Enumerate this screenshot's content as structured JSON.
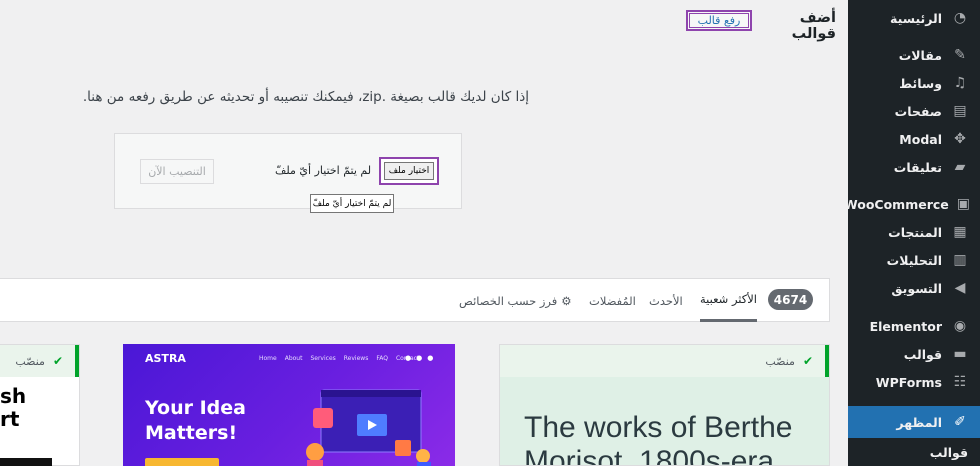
{
  "sidebar": {
    "items": [
      {
        "label": "الرئيسية",
        "icon": "dashboard-icon"
      },
      {
        "label": "مقالات",
        "icon": "pin-icon"
      },
      {
        "label": "وسائط",
        "icon": "media-icon"
      },
      {
        "label": "صفحات",
        "icon": "pages-icon"
      },
      {
        "label": "Modal",
        "icon": "move-icon"
      },
      {
        "label": "تعليقات",
        "icon": "comment-icon"
      },
      {
        "label": "WooCommerce",
        "icon": "woo-icon"
      },
      {
        "label": "المنتجات",
        "icon": "products-icon"
      },
      {
        "label": "التحليلات",
        "icon": "analytics-icon"
      },
      {
        "label": "التسويق",
        "icon": "megaphone-icon"
      },
      {
        "label": "Elementor",
        "icon": "elementor-icon"
      },
      {
        "label": "قوالب",
        "icon": "folder-icon"
      },
      {
        "label": "WPForms",
        "icon": "forms-icon"
      },
      {
        "label": "المظهر",
        "icon": "brush-icon"
      },
      {
        "label": "قوالب",
        "icon": ""
      }
    ]
  },
  "header": {
    "title": "أضف قوالب",
    "upload_label": "رفع قالب"
  },
  "upload": {
    "description": "إذا كان لديك قالب بصيغة .zip، فيمكنك تنصيبه أو تحديثه عن طريق رفعه من هنا.",
    "choose_label": "اختيار ملف",
    "no_file": "لم يتمّ اختيار أيّ ملفّ",
    "tooltip": "لم يتمّ اختيار أيّ ملفّ",
    "install_label": "التنصيب الآن"
  },
  "filter": {
    "count": "4674",
    "tabs": [
      {
        "label": "الأكثر شعبية",
        "active": true
      },
      {
        "label": "الأحدث",
        "active": false
      },
      {
        "label": "المُفضلات",
        "active": false
      },
      {
        "label": "فرز حسب الخصائص",
        "active": false
      }
    ]
  },
  "themes": {
    "installed_label": "منصّب",
    "left_text_1": "sh",
    "left_text_2": "rt",
    "astra": {
      "logo": "ASTRA",
      "nav": [
        "Home",
        "About",
        "Services",
        "Reviews",
        "FAQ",
        "Contact"
      ],
      "title_1": "Your Idea",
      "title_2": "Matters!"
    },
    "right": {
      "title_1": "The works of Berthe",
      "title_2": "Morisot, 1800s-era"
    }
  },
  "colors": {
    "sidebar_bg": "#1d2327",
    "sidebar_active": "#2271b1",
    "highlight_border": "#8e44ad",
    "installed_green": "#00a32a",
    "astra_purple": "#5a1be0"
  }
}
